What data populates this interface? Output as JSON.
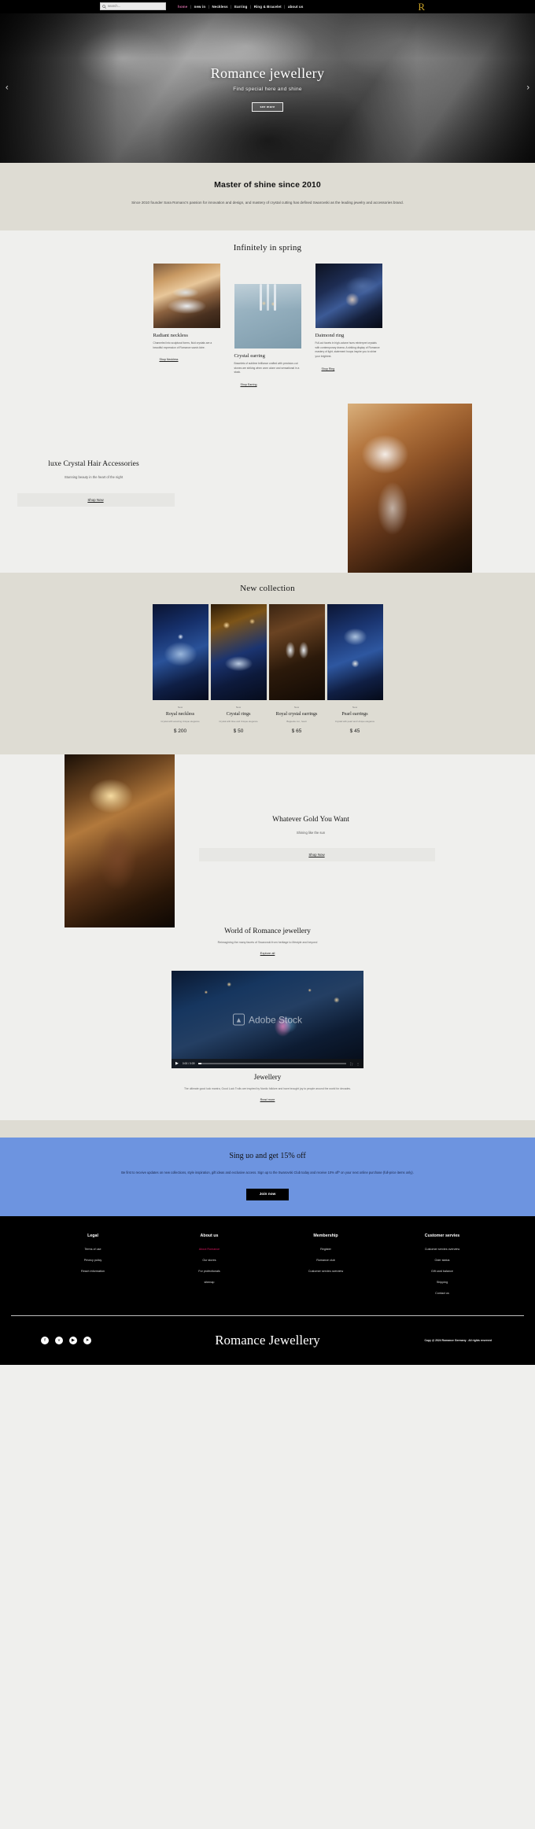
{
  "nav": {
    "search_placeholder": "search...",
    "search_value": "",
    "links": [
      {
        "label": "home",
        "active": true
      },
      {
        "label": "new in",
        "active": false
      },
      {
        "label": "Neckless",
        "active": false
      },
      {
        "label": "Earring",
        "active": false
      },
      {
        "label": "Ring & Bracelet",
        "active": false
      },
      {
        "label": "about us",
        "active": false
      }
    ],
    "separator": "|",
    "logo": "R"
  },
  "hero": {
    "title": "Romance jewellery",
    "subtitle": "Find special here and shine",
    "button": "see more",
    "arrow_prev": "‹",
    "arrow_next": "›"
  },
  "about": {
    "title": "Master of shine since 2010",
    "text": "Since 2010 founder Sara Romanc's passion for innovation and design, and mastery of crystal cutting has defined Swarovski as the leading jewelry and accessories brand."
  },
  "spring": {
    "title": "Infinitely in spring",
    "cards": [
      {
        "name": "Radiant neckless",
        "desc": "Channeled into sculptural forms, fluid crystals are a beautiful expression of Romance savoir-faire.",
        "link": "Shop Neckless"
      },
      {
        "name": "Crystal earring",
        "desc": "Bracelets of sublime brilliance crafted with precision-cut stones are striking when worn alone and sensational in a stack.",
        "link": "Shop Earring"
      },
      {
        "name": "Daimond ring",
        "desc": "Full-cut facets in high-octane hues reinterpret crystals with contemporary drama. A striking display of Romance mastery of light, statement hoops inspire you to shine your brightest.",
        "link": "Shop Ring"
      }
    ]
  },
  "luxe": {
    "title": "luxe Crystal Hair Accessories",
    "subtitle": "Stunning beauty in the heart of the night",
    "button": "Shop Now"
  },
  "new_collection": {
    "title": "New collection",
    "items": [
      {
        "tag": "New",
        "name": "Royal neckless",
        "desc": "Crystal with amazing Unique elegance",
        "price": "$ 200"
      },
      {
        "tag": "New",
        "name": "Crystal rings",
        "desc": "Crystal with blue and Unique elegance",
        "price": "$ 50"
      },
      {
        "tag": "New",
        "name": "Royal crystal earrings",
        "desc": "Baguette cut , heart",
        "price": "$ 65"
      },
      {
        "tag": "New",
        "name": "Pearl earrings",
        "desc": "Crystal with pearl and Unique elegance",
        "price": "$ 45"
      }
    ]
  },
  "gold": {
    "title": "Whatever Gold You Want",
    "subtitle": "Shining like the sun",
    "button": "Shop Now"
  },
  "world": {
    "title": "World of Romance jewellery",
    "subtitle": "Reimagining the many facets of Swarovski from heritage to lifestyle and beyond",
    "link": "Explore all"
  },
  "video": {
    "watermark": "Adobe Stock",
    "watermark_logo": "▲",
    "play_icon": "▶",
    "time": "0:00 / 0:09",
    "fullscreen_icon": "⛶",
    "menu_icon": "⋮"
  },
  "jewellery_caption": {
    "title": "Jewellery",
    "text": "The ultimate good luck mantra, Good Luck Trolls are inspired by Nordic folklore and have brought joy to people around the world for decades.",
    "link": "Read more"
  },
  "signup": {
    "title": "Sing uo and get 15% off",
    "text": "Be first to receive updates on new collections, style inspiration, gift ideas and exclusive access. Sign up to the Swarovski Club today and receive 10% off* on your next online purchase (full-price items only).",
    "button": "Join now"
  },
  "footer": {
    "columns": [
      {
        "title": "Legal",
        "links": [
          {
            "label": "Terms of use",
            "highlight": false
          },
          {
            "label": "Privecy policy",
            "highlight": false
          },
          {
            "label": "Reach information",
            "highlight": false
          }
        ]
      },
      {
        "title": "About us",
        "links": [
          {
            "label": "About Romance",
            "highlight": true
          },
          {
            "label": "Our stores",
            "highlight": false
          },
          {
            "label": "For profectionals",
            "highlight": false
          },
          {
            "label": "sitemap",
            "highlight": false
          }
        ]
      },
      {
        "title": "Membership",
        "links": [
          {
            "label": "Register",
            "highlight": false
          },
          {
            "label": "Romance club",
            "highlight": false
          },
          {
            "label": "Customer servies overview",
            "highlight": false
          }
        ]
      },
      {
        "title": "Customer servies",
        "links": [
          {
            "label": "Customer servies overview",
            "highlight": false
          },
          {
            "label": "Oder status",
            "highlight": false
          },
          {
            "label": "Gift card balance",
            "highlight": false
          },
          {
            "label": "Shipping",
            "highlight": false
          },
          {
            "label": "Contact us",
            "highlight": false
          }
        ]
      }
    ],
    "social": [
      {
        "name": "facebook-icon",
        "glyph": "f"
      },
      {
        "name": "twitter-icon",
        "glyph": "ᴠ"
      },
      {
        "name": "youtube-icon",
        "glyph": "▶"
      },
      {
        "name": "telegram-icon",
        "glyph": "➤"
      }
    ],
    "brand": "Romance Jewellery",
    "copyright": "Copy @ 2024 Romance Germany . All rights reserved"
  }
}
